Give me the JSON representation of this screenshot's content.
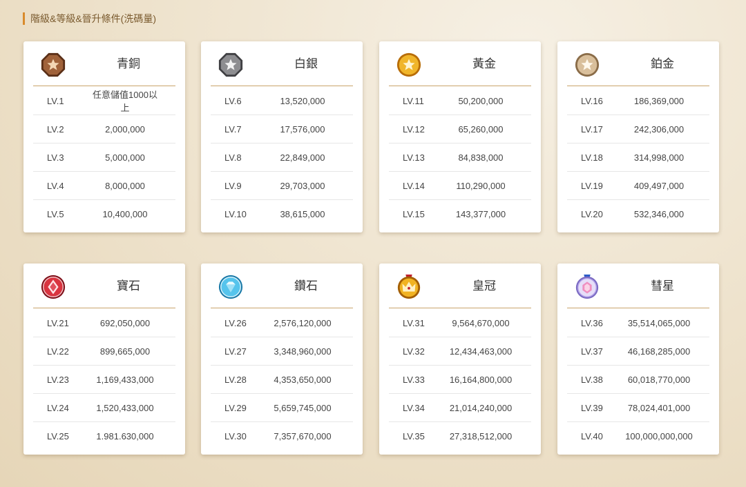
{
  "page_title": "階級&等級&晉升條件(洗碼量)",
  "tiers": [
    {
      "name": "青銅",
      "icon": "bronze-medal-icon",
      "color": "#8a4f2c",
      "rows": [
        [
          "LV.1",
          "任意儲值1000以上"
        ],
        [
          "LV.2",
          "2,000,000"
        ],
        [
          "LV.3",
          "5,000,000"
        ],
        [
          "LV.4",
          "8,000,000"
        ],
        [
          "LV.5",
          "10,400,000"
        ]
      ]
    },
    {
      "name": "白銀",
      "icon": "silver-medal-icon",
      "color": "#6e6e70",
      "rows": [
        [
          "LV.6",
          "13,520,000"
        ],
        [
          "LV.7",
          "17,576,000"
        ],
        [
          "LV.8",
          "22,849,000"
        ],
        [
          "LV.9",
          "29,703,000"
        ],
        [
          "LV.10",
          "38,615,000"
        ]
      ]
    },
    {
      "name": "黃金",
      "icon": "gold-medal-icon",
      "color": "#d9961c",
      "rows": [
        [
          "LV.11",
          "50,200,000"
        ],
        [
          "LV.12",
          "65,260,000"
        ],
        [
          "LV.13",
          "84,838,000"
        ],
        [
          "LV.14",
          "110,290,000"
        ],
        [
          "LV.15",
          "143,377,000"
        ]
      ]
    },
    {
      "name": "鉑金",
      "icon": "platinum-medal-icon",
      "color": "#b89770",
      "rows": [
        [
          "LV.16",
          "186,369,000"
        ],
        [
          "LV.17",
          "242,306,000"
        ],
        [
          "LV.18",
          "314,998,000"
        ],
        [
          "LV.19",
          "409,497,000"
        ],
        [
          "LV.20",
          "532,346,000"
        ]
      ]
    },
    {
      "name": "寶石",
      "icon": "gem-medal-icon",
      "color": "#c8202e",
      "rows": [
        [
          "LV.21",
          "692,050,000"
        ],
        [
          "LV.22",
          "899,665,000"
        ],
        [
          "LV.23",
          "1,169,433,000"
        ],
        [
          "LV.24",
          "1,520,433,000"
        ],
        [
          "LV.25",
          "1.981.630,000"
        ]
      ]
    },
    {
      "name": "鑽石",
      "icon": "diamond-medal-icon",
      "color": "#2aa6d8",
      "rows": [
        [
          "LV.26",
          "2,576,120,000"
        ],
        [
          "LV.27",
          "3,348,960,000"
        ],
        [
          "LV.28",
          "4,353,650,000"
        ],
        [
          "LV.29",
          "5,659,745,000"
        ],
        [
          "LV.30",
          "7,357,670,000"
        ]
      ]
    },
    {
      "name": "皇冠",
      "icon": "crown-medal-icon",
      "color": "#e2a012",
      "rows": [
        [
          "LV.31",
          "9,564,670,000"
        ],
        [
          "LV.32",
          "12,434,463,000"
        ],
        [
          "LV.33",
          "16,164,800,000"
        ],
        [
          "LV.34",
          "21,014,240,000"
        ],
        [
          "LV.35",
          "27,318,512,000"
        ]
      ]
    },
    {
      "name": "彗星",
      "icon": "comet-medal-icon",
      "color": "#9b7fd6",
      "rows": [
        [
          "LV.36",
          "35,514,065,000"
        ],
        [
          "LV.37",
          "46,168,285,000"
        ],
        [
          "LV.38",
          "60,018,770,000"
        ],
        [
          "LV.39",
          "78,024,401,000"
        ],
        [
          "LV.40",
          "100,000,000,000"
        ]
      ]
    }
  ]
}
